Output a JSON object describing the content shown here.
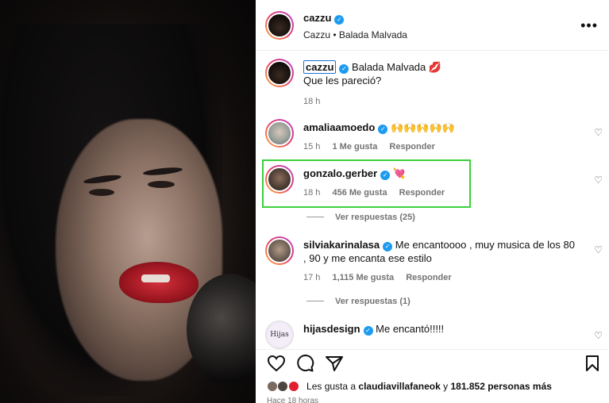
{
  "post": {
    "username": "cazzu",
    "subtitle_user": "Cazzu",
    "subtitle_sep": "•",
    "subtitle_song": "Balada Malvada",
    "more_label": "•••"
  },
  "caption": {
    "username": "cazzu",
    "text_line1": "Balada Malvada",
    "emoji": "💋",
    "text_line2": "Que les pareció?",
    "time": "18 h"
  },
  "comments": [
    {
      "username": "amaliaamoedo",
      "text": "🙌🙌🙌🙌🙌",
      "time": "15 h",
      "likes": "1 Me gusta",
      "reply": "Responder"
    },
    {
      "username": "gonzalo.gerber",
      "text": "💘",
      "time": "18 h",
      "likes": "456 Me gusta",
      "reply": "Responder",
      "view_replies": "Ver respuestas (25)"
    },
    {
      "username": "silviakarinalasa",
      "text": "Me encantoooo , muy musica de los 80 , 90 y me encanta ese estilo",
      "time": "17 h",
      "likes": "1,115 Me gusta",
      "reply": "Responder",
      "view_replies": "Ver respuestas (1)"
    },
    {
      "username": "hijasdesign",
      "text": "Me encantó!!!!!",
      "avatar_text": "Hijas"
    }
  ],
  "likes_line": {
    "prefix": "Les gusta a",
    "user": "claudiavillafaneok",
    "middle": "y",
    "count": "181.852 personas más"
  },
  "timestamp": "Hace 18 horas",
  "icons": {
    "like": "heart-icon",
    "comment": "comment-icon",
    "share": "send-icon",
    "save": "bookmark-icon",
    "verified": "verified-badge-icon"
  },
  "colors": {
    "verified": "#1d9bf0",
    "highlight": "#3bd13b",
    "secondary_text": "#737373"
  }
}
